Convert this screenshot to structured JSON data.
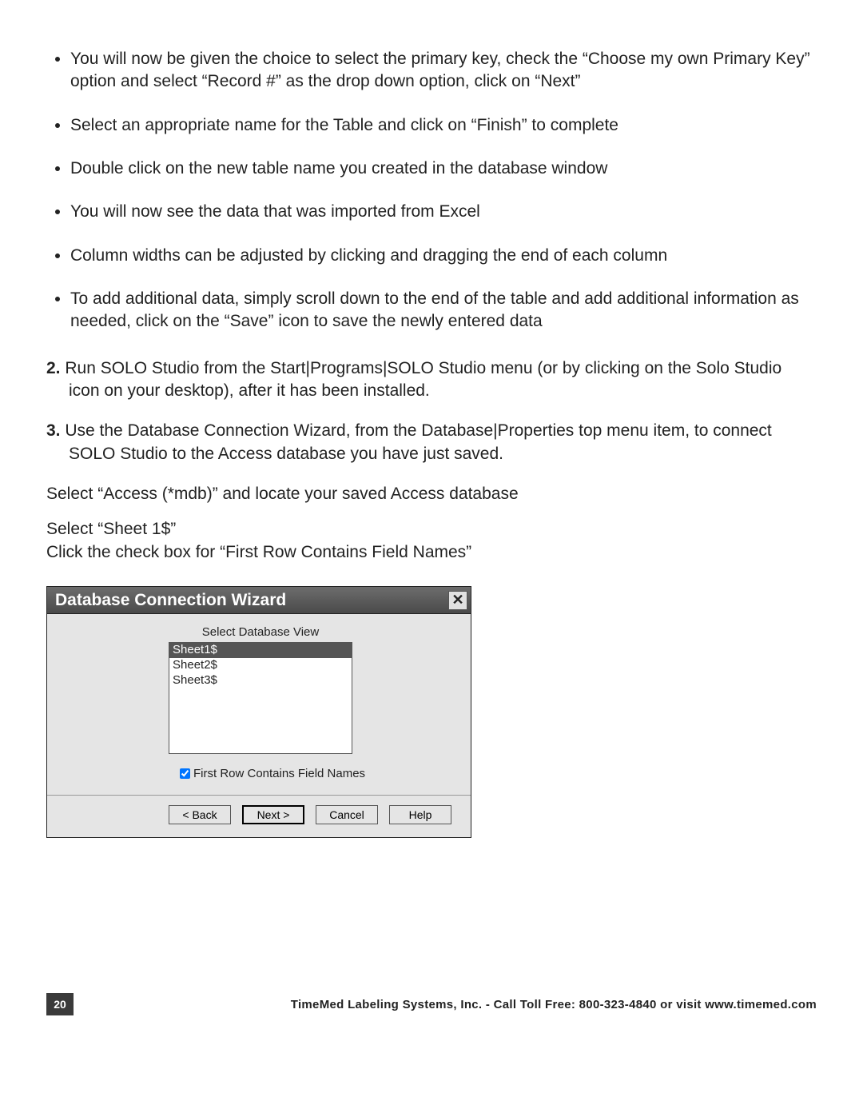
{
  "bullets": [
    "You will now be given the choice to select the primary key, check the “Choose my own Primary Key” option and select “Record #” as the drop down option, click on “Next”",
    "Select an appropriate name for the Table and click on “Finish” to complete",
    "Double click on the new table name you created in the database window",
    "You will now see the data that was imported from Excel",
    "Column widths can be adjusted by clicking and dragging the end of each column",
    "To add additional data, simply scroll down to the end of the table and add additional information as needed, click on the “Save” icon to save the newly entered data"
  ],
  "numbered": [
    {
      "num": "2.",
      "text": "Run SOLO Studio from the Start|Programs|SOLO Studio menu (or by clicking on the Solo Studio icon on your desktop), after it has been installed."
    },
    {
      "num": "3.",
      "text": "Use the Database Connection Wizard, from the Database|Properties top menu item, to connect SOLO Studio to the Access database you have just saved."
    }
  ],
  "paras": {
    "p1": "Select “Access (*mdb)” and locate your saved Access database",
    "p2": "Select “Sheet 1$”",
    "p3": "Click the check box for “First Row Contains Field Names”"
  },
  "dialog": {
    "title": "Database Connection Wizard",
    "close": "✕",
    "listLabel": "Select Database View",
    "items": [
      "Sheet1$",
      "Sheet2$",
      "Sheet3$"
    ],
    "selectedIndex": 0,
    "checkboxLabel": "First Row Contains Field Names",
    "checkboxChecked": true,
    "buttons": {
      "back": "< Back",
      "next": "Next >",
      "cancel": "Cancel",
      "help": "Help"
    }
  },
  "footer": {
    "page": "20",
    "text": "TimeMed Labeling Systems, Inc. - Call Toll Free: 800-323-4840 or visit www.timemed.com"
  }
}
